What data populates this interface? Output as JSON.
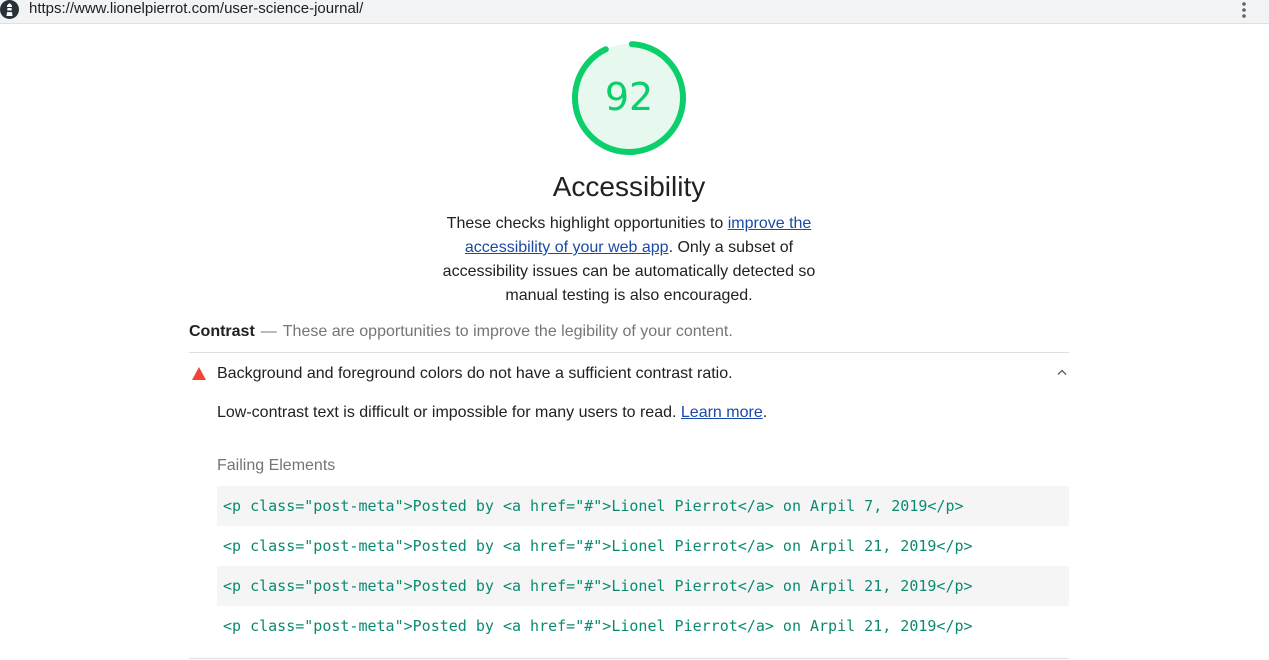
{
  "browser": {
    "url": "https://www.lionelpierrot.com/user-science-journal/",
    "logo_icon": "lighthouse-logo-icon",
    "menu_icon": "more-vertical-icon"
  },
  "gauge": {
    "score": "92",
    "fraction": 0.92,
    "color": "#0cce6b",
    "fill": "#e7f8ee"
  },
  "category": {
    "title": "Accessibility",
    "desc_before": "These checks highlight opportunities to ",
    "desc_link": "improve the accessibility of your web app",
    "desc_after": ". Only a subset of accessibility issues can be automatically detected so manual testing is also encouraged."
  },
  "group": {
    "title": "Contrast",
    "separator": "—",
    "description": "These are opportunities to improve the legibility of your content."
  },
  "audit": {
    "status_icon": "warning-triangle-icon",
    "status_color": "#f44336",
    "title": "Background and foreground colors do not have a sufficient contrast ratio.",
    "toggle_icon": "chevron-up-icon",
    "desc_text": "Low-contrast text is difficult or impossible for many users to read. ",
    "learn_more": "Learn more",
    "desc_end": ".",
    "table_heading": "Failing Elements",
    "failing_elements": [
      "<p class=\"post-meta\">Posted by <a href=\"#\">Lionel Pierrot</a> on Arpil 7, 2019</p>",
      "<p class=\"post-meta\">Posted by <a href=\"#\">Lionel Pierrot</a> on Arpil 21, 2019</p>",
      "<p class=\"post-meta\">Posted by <a href=\"#\">Lionel Pierrot</a> on Arpil 21, 2019</p>",
      "<p class=\"post-meta\">Posted by <a href=\"#\">Lionel Pierrot</a> on Arpil 21, 2019</p>"
    ]
  }
}
